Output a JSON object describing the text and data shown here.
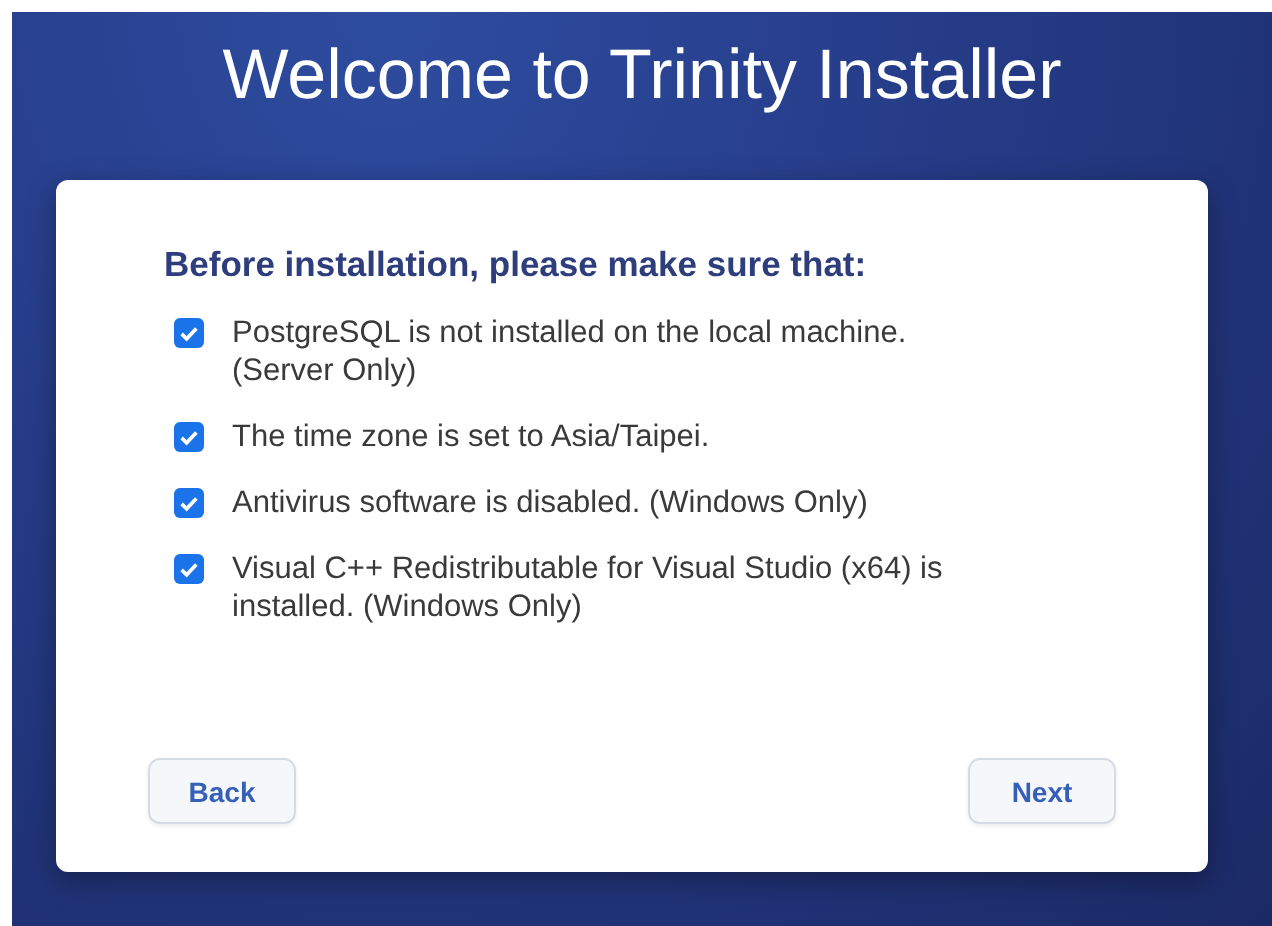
{
  "title": "Welcome to Trinity Installer",
  "heading": "Before installation, please make sure that:",
  "items": [
    {
      "label": "PostgreSQL is not installed on the local machine. (Server Only)",
      "checked": true
    },
    {
      "label": "The time zone is set to Asia/Taipei.",
      "checked": true
    },
    {
      "label": "Antivirus software is disabled. (Windows Only)",
      "checked": true
    },
    {
      "label": "Visual C++ Redistributable for Visual Studio (x64) is installed. (Windows Only)",
      "checked": true
    }
  ],
  "buttons": {
    "back": "Back",
    "next": "Next"
  }
}
